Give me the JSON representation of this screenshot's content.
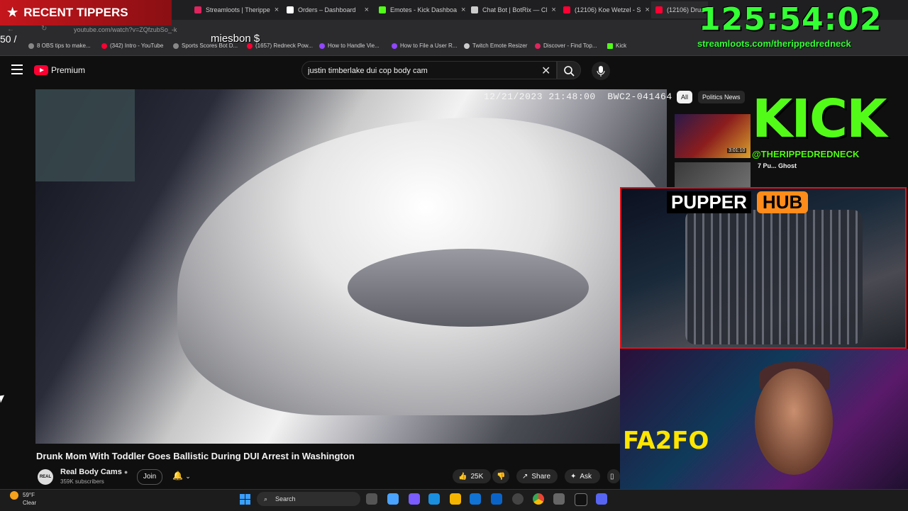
{
  "browser": {
    "tabs": [
      {
        "label": "Streamloots | Therippe",
        "color": "#e0245e"
      },
      {
        "label": "Orders – Dashboard",
        "color": "#ffffff"
      },
      {
        "label": "Emotes - Kick Dashboa",
        "color": "#53fc18"
      },
      {
        "label": "Chat Bot | BotRix — Cl",
        "color": "#cccccc"
      },
      {
        "label": "(12106) Koe Wetzel - S",
        "color": "#ff0033"
      },
      {
        "label": "(12106) Drunk",
        "color": "#ff0033"
      }
    ],
    "url": "youtube.com/watch?v=ZQfzubSo_-k",
    "bookmarks": [
      {
        "label": "8 OBS tips to make...",
        "color": "#888888"
      },
      {
        "label": "(342) Intro - YouTube",
        "color": "#ff0033"
      },
      {
        "label": "Sports Scores Bot D...",
        "color": "#888888"
      },
      {
        "label": "(1657) Redneck Pow...",
        "color": "#ff0033"
      },
      {
        "label": "How to Handle Vie...",
        "color": "#9146ff"
      },
      {
        "label": "How to File a User R...",
        "color": "#9146ff"
      },
      {
        "label": "Twitch Emote Resizer",
        "color": "#cccccc"
      },
      {
        "label": "Discover - Find Top...",
        "color": "#e0245e"
      },
      {
        "label": "Kick",
        "color": "#53fc18"
      }
    ]
  },
  "youtube": {
    "logo_label": "Premium",
    "search_query": "justin timberlake dui cop body cam",
    "chips": [
      "All",
      "Politics News"
    ],
    "video": {
      "timestamp": "12/21/2023 21:48:00",
      "camera_id": "BWC2-041464",
      "title": "Drunk Mom With Toddler Goes Ballistic During DUI Arrest in Washington",
      "channel": "Real Body Cams",
      "channel_avatar": "REAL",
      "subscribers": "359K subscribers",
      "join_label": "Join",
      "likes": "25K",
      "share_label": "Share",
      "ask_label": "Ask"
    },
    "recommendations": [
      {
        "duration": "3:01:10"
      },
      {
        "title": "7 Pu... Ghost"
      }
    ]
  },
  "overlays": {
    "recent_tippers": "RECENT TIPPERS",
    "timer": "125:54:02",
    "streamloots_url": "streamloots.com/therippedredneck",
    "kick_logo": "KICK",
    "kick_handle": "@THERIPPEDREDNECK",
    "pupper_word1": "PUPPER",
    "pupper_word2": "HUB",
    "tip_name": "miesbon $",
    "partial_amount": "50 /",
    "webcam_sign": "FA2FO"
  },
  "taskbar": {
    "temperature": "59°F",
    "condition": "Clear",
    "search_label": "Search"
  }
}
